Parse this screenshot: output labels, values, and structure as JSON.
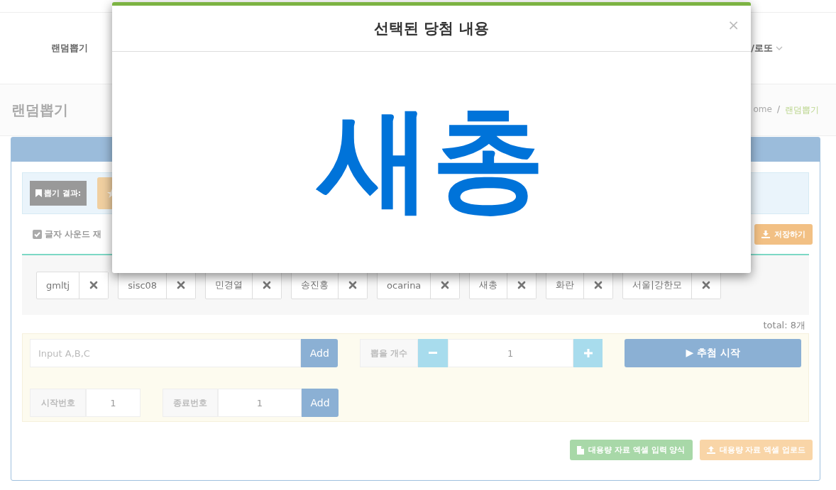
{
  "nav": {
    "items": [
      {
        "label": "랜덤뽑기",
        "dropdown": false
      },
      {
        "label": "/로또",
        "dropdown": true
      }
    ]
  },
  "page_header": {
    "title": "랜덤뽑기",
    "breadcrumb": [
      "ome",
      "랜덤뽑기"
    ],
    "separator": "/"
  },
  "result_bar": {
    "label": "뽑기 결과:"
  },
  "sound": {
    "label": "글자 사운드 재",
    "checked": true
  },
  "save_button": "저장하기",
  "tags": [
    {
      "label": "gmltj"
    },
    {
      "label": "sisc08"
    },
    {
      "label": "민경열"
    },
    {
      "label": "송진홍"
    },
    {
      "label": "ocarina"
    },
    {
      "label": "새총"
    },
    {
      "label": "화란"
    },
    {
      "label": "서울|강한모"
    }
  ],
  "total": "total: 8개",
  "entry": {
    "placeholder": "Input A,B,C",
    "add": "Add"
  },
  "count": {
    "label": "뽑을 개수",
    "value": "1"
  },
  "start_button": "▶ 추첨 시작",
  "range": {
    "start_label": "시작번호",
    "start_value": "1",
    "end_label": "종료번호",
    "end_value": "1",
    "add": "Add"
  },
  "excel": {
    "template_button": "대용량 자료 엑셀 입력 양식",
    "upload_button": "대용량 자료 엑셀 업로드"
  },
  "modal": {
    "title": "선택된 당첨 내용",
    "close": "×",
    "winner": "새총"
  }
}
